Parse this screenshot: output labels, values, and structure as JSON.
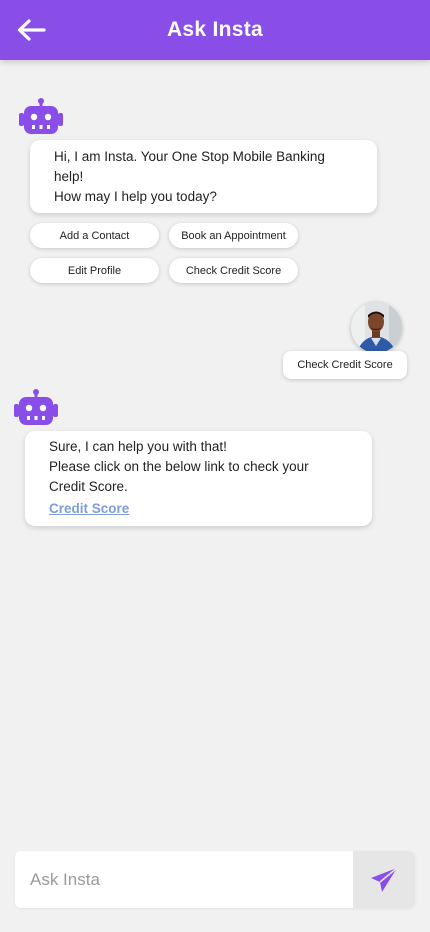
{
  "header": {
    "title": "Ask Insta",
    "back_icon": "arrow-left-icon",
    "color": "#8a4ee8"
  },
  "conversation": {
    "bot_message_1": {
      "lines": [
        "Hi, I am Insta. Your One Stop Mobile Banking",
        "help!",
        "How may I help you today?"
      ]
    },
    "quick_replies": [
      "Add a Contact",
      "Book an Appointment",
      "Edit Profile",
      "Check Credit Score"
    ],
    "user_message": "Check Credit Score",
    "bot_message_2": {
      "lines": [
        "Sure, I can help you with that!",
        "Please click on the below link to check your",
        "Credit Score."
      ],
      "link_text": "Credit Score"
    }
  },
  "composer": {
    "placeholder": "Ask Insta",
    "send_icon": "send-icon",
    "send_color": "#8a4ee8"
  }
}
